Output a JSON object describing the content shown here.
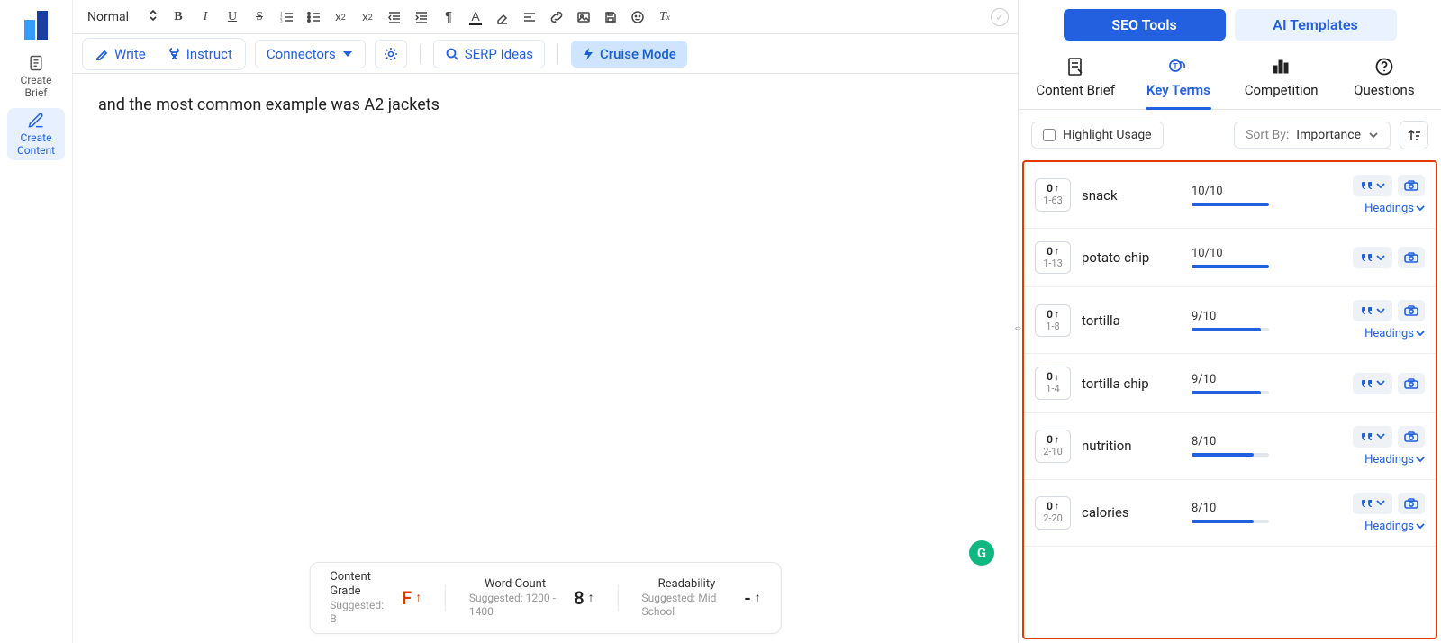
{
  "left_rail": {
    "create_brief": "Create\nBrief",
    "create_content": "Create\nContent"
  },
  "toolbar1": {
    "style": "Normal"
  },
  "toolbar2": {
    "write": "Write",
    "instruct": "Instruct",
    "connectors": "Connectors",
    "serp_ideas": "SERP Ideas",
    "cruise_mode": "Cruise Mode"
  },
  "editor": {
    "content": "and the most common example was A2 jackets"
  },
  "footer": {
    "grade_label": "Content Grade",
    "grade_suggested": "Suggested: B",
    "grade_value": "F",
    "wc_label": "Word Count",
    "wc_suggested": "Suggested: 1200 - 1400",
    "wc_value": "8",
    "read_label": "Readability",
    "read_suggested": "Suggested: Mid School",
    "read_value": "-"
  },
  "right": {
    "seo_tab": "SEO Tools",
    "ai_tab": "AI Templates",
    "sub": {
      "brief": "Content Brief",
      "terms": "Key Terms",
      "competition": "Competition",
      "questions": "Questions"
    },
    "highlight": "Highlight Usage",
    "sort_label": "Sort By:",
    "sort_value": "Importance",
    "headings": "Headings",
    "terms": [
      {
        "count": "0",
        "range": "1-63",
        "name": "snack",
        "score": "10/10",
        "pct": 100,
        "headings": true
      },
      {
        "count": "0",
        "range": "1-13",
        "name": "potato chip",
        "score": "10/10",
        "pct": 100,
        "headings": false
      },
      {
        "count": "0",
        "range": "1-8",
        "name": "tortilla",
        "score": "9/10",
        "pct": 90,
        "headings": true
      },
      {
        "count": "0",
        "range": "1-4",
        "name": "tortilla chip",
        "score": "9/10",
        "pct": 90,
        "headings": false
      },
      {
        "count": "0",
        "range": "2-10",
        "name": "nutrition",
        "score": "8/10",
        "pct": 80,
        "headings": true
      },
      {
        "count": "0",
        "range": "2-20",
        "name": "calories",
        "score": "8/10",
        "pct": 80,
        "headings": true
      }
    ]
  },
  "grammarly": "G"
}
